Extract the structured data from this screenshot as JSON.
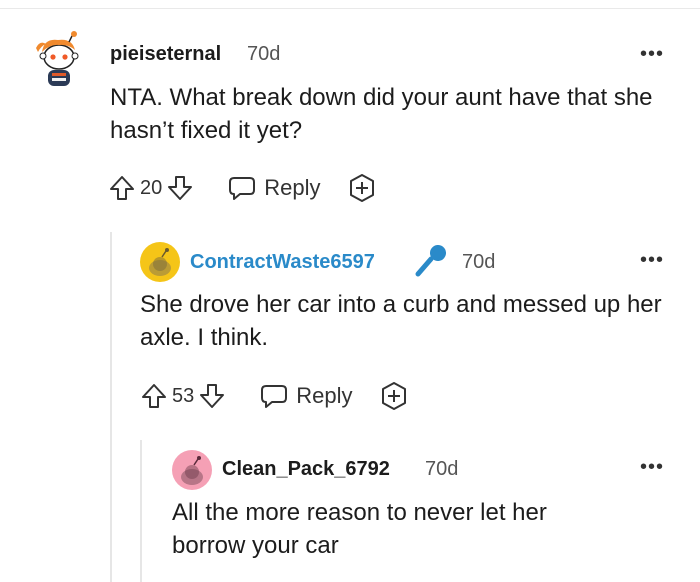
{
  "comments": [
    {
      "username": "pieiseternal",
      "age": "70d",
      "body": "NTA. What break down did your aunt have that she hasn’t fixed it yet?",
      "score": "20",
      "reply_label": "Reply",
      "more": "•••"
    },
    {
      "username": "ContractWaste6597",
      "age": "70d",
      "body": "She drove her car into a curb and messed up her axle. I think.",
      "score": "53",
      "reply_label": "Reply",
      "more": "•••",
      "username_color": "#2a8ac9"
    },
    {
      "username": "Clean_Pack_6792",
      "age": "70d",
      "body": "All the more reason to never let her borrow your car",
      "more": "•••"
    }
  ]
}
